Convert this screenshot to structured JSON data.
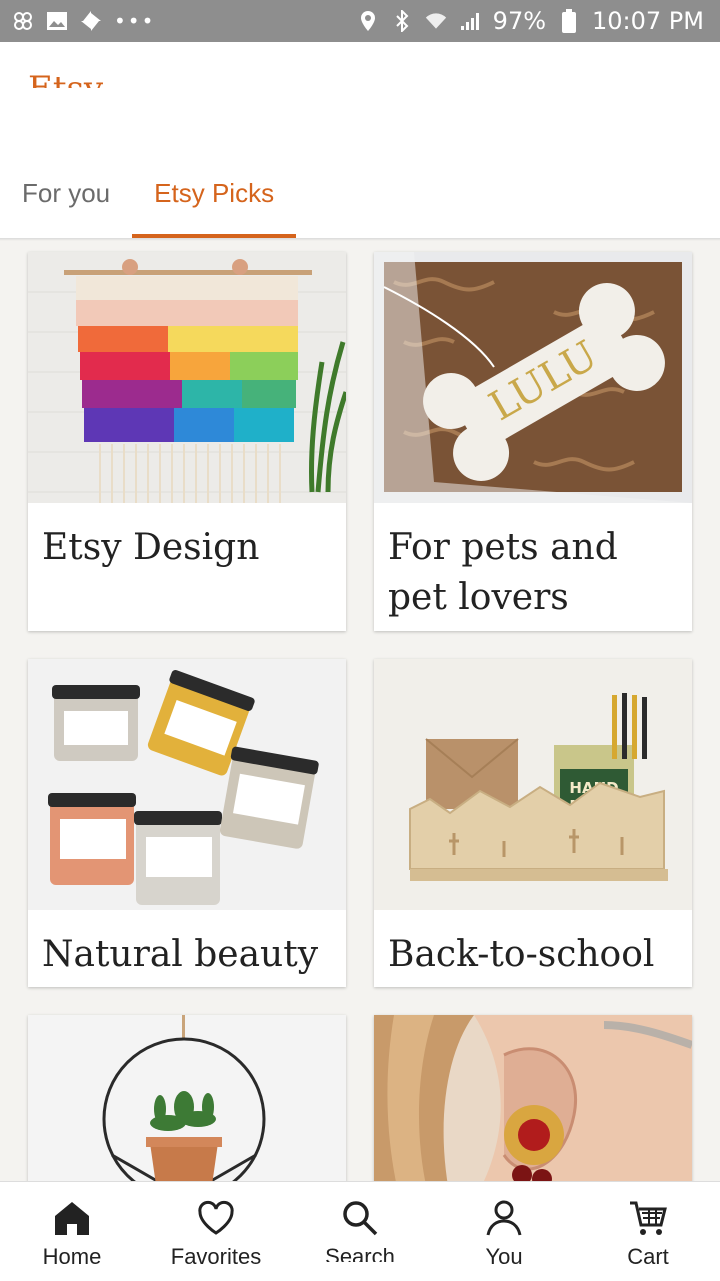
{
  "status_bar": {
    "battery": "97%",
    "time": "10:07 PM",
    "left_icons": [
      "pinwheel-icon",
      "image-icon",
      "fan-icon",
      "more-dots-icon"
    ],
    "right_icons": [
      "location-icon",
      "bluetooth-icon",
      "wifi-icon",
      "signal-icon",
      "battery-icon"
    ]
  },
  "header": {
    "logo": "Etsy",
    "tabs": [
      {
        "label": "For you",
        "active": false
      },
      {
        "label": "Etsy Picks",
        "active": true
      }
    ],
    "accent_color": "#d5641c"
  },
  "cards": [
    {
      "label": "Etsy Design",
      "image": "rainbow-wool-wall-hanging"
    },
    {
      "label": "For pets and pet lovers",
      "image": "lulu-bone-ornament"
    },
    {
      "label": "Natural beauty",
      "image": "skincare-jars"
    },
    {
      "label": "Back-to-school",
      "image": "desert-desk-organizer"
    },
    {
      "label": "",
      "image": "hanging-plant-ring"
    },
    {
      "label": "",
      "image": "statement-earring"
    }
  ],
  "bottom_nav": [
    {
      "label": "Home",
      "icon": "home-icon",
      "active": true
    },
    {
      "label": "Favorites",
      "icon": "heart-icon"
    },
    {
      "label": "Search",
      "icon": "search-icon"
    },
    {
      "label": "You",
      "icon": "person-icon"
    },
    {
      "label": "Cart",
      "icon": "cart-icon"
    }
  ]
}
